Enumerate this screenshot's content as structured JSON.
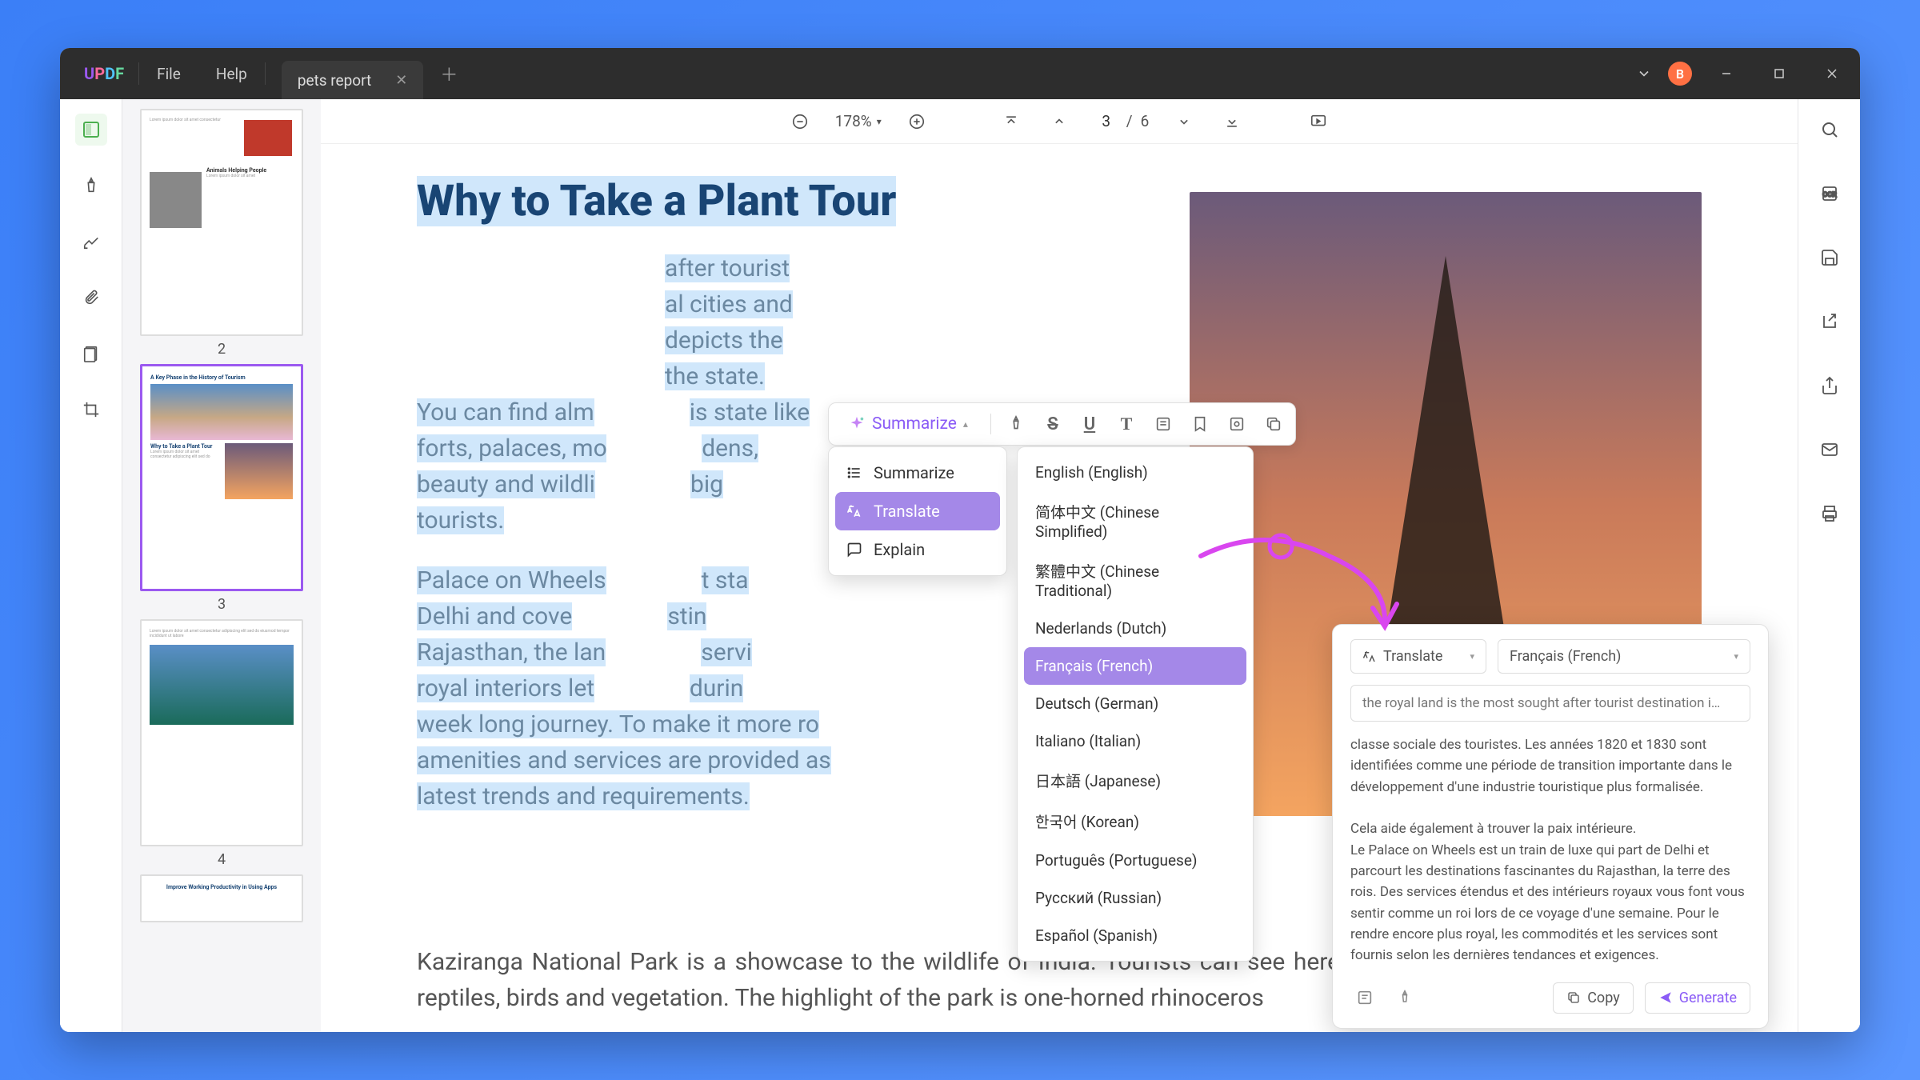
{
  "titlebar": {
    "file": "File",
    "help": "Help",
    "tab_name": "pets report",
    "avatar_letter": "B"
  },
  "toolbar": {
    "zoom": "178%",
    "current_page": "3",
    "page_sep": "/",
    "total_pages": "6"
  },
  "thumbs": {
    "n2": "2",
    "n3": "3",
    "n4": "4",
    "t3_h1": "A Key Phase in the History of Tourism",
    "t3_h2": "Why to Take a Plant Tour",
    "t5_h": "Improve Working Productivity in Using Apps"
  },
  "doc": {
    "title": "Why to Take a Plant Tour",
    "p1a": "after tourist",
    "p1b": "al cities and",
    "p1c": "depicts the",
    "p1d": "the state.",
    "p1e": "You can find alm",
    "p1f": "is state like",
    "p1g": "forts, palaces, mo",
    "p1h": "dens,",
    "p1i": "beauty and wildli",
    "p1j": "big",
    "p1k": "tourists.",
    "p2a": "Palace on Wheels",
    "p2b": "t sta",
    "p2c": "Delhi and cove",
    "p2d": "stin",
    "p2e": "Rajasthan, the lan",
    "p2f": "servi",
    "p2g": "royal interiors let",
    "p2h": "durin",
    "p2i": "week long journey. To make it more ro",
    "p2j": "amenities and services are provided as",
    "p2k": "latest trends and requirements.",
    "p3": "Kaziranga National Park is a showcase to the wildlife of India. Tourists can see here an exclusive range of mammals, reptiles, birds and vegetation. The highlight of the park is one-horned rhinoceros"
  },
  "float_toolbar": {
    "summarize": "Summarize"
  },
  "ai_menu": {
    "summarize": "Summarize",
    "translate": "Translate",
    "explain": "Explain"
  },
  "languages": {
    "en": "English (English)",
    "zhs": "简体中文 (Chinese Simplified)",
    "zht": "繁體中文 (Chinese Traditional)",
    "nl": "Nederlands (Dutch)",
    "fr": "Français (French)",
    "de": "Deutsch (German)",
    "it": "Italiano (Italian)",
    "ja": "日本語 (Japanese)",
    "ko": "한국어 (Korean)",
    "pt": "Português (Portuguese)",
    "ru": "Русский (Russian)",
    "es": "Español (Spanish)"
  },
  "translate_panel": {
    "mode": "Translate",
    "target_lang": "Français (French)",
    "source_text": "the royal land is the most sought after tourist destination i…",
    "result": "classe sociale des touristes. Les années 1820 et 1830 sont identifiées comme une période de transition importante dans le développement d'une industrie touristique plus formalisée.\n\nCela aide également à trouver la paix intérieure.\nLe Palace on Wheels est un train de luxe qui part de Delhi et parcourt les destinations fascinantes du Rajasthan, la terre des rois. Des services étendus et des intérieurs royaux vous font vous sentir comme un roi lors de ce voyage d'une semaine. Pour le rendre encore plus royal, les commodités et les services sont fournis selon les dernières tendances et exigences.",
    "copy": "Copy",
    "generate": "Generate"
  }
}
